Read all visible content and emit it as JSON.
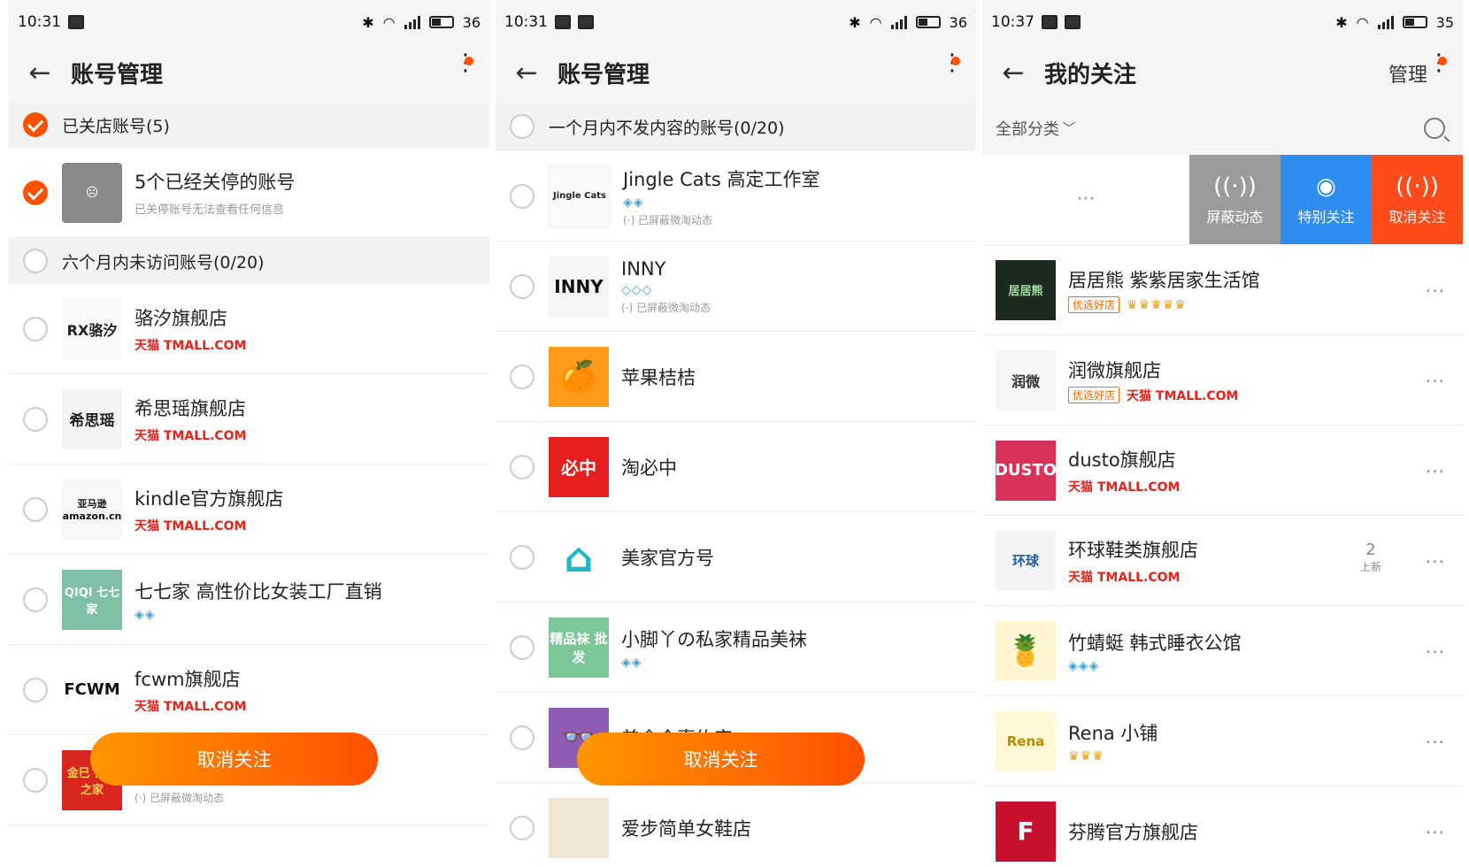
{
  "screens": [
    {
      "status": {
        "time": "10:31",
        "battery": "36"
      },
      "header": {
        "title": "账号管理"
      },
      "group1": {
        "label": "已关店账号(5)"
      },
      "closed_row": {
        "name": "5个已经关停的账号",
        "sub": "已关停账号无法查看任何信息"
      },
      "group2": {
        "label": "六个月内未访问账号(0/20)"
      },
      "rows": [
        {
          "name": "骆汐旗舰店",
          "tag": "天猫 TMALL.COM",
          "logo": "RX骆汐"
        },
        {
          "name": "希思瑶旗舰店",
          "tag": "天猫 TMALL.COM",
          "logo": "希思瑶"
        },
        {
          "name": "kindle官方旗舰店",
          "tag": "天猫 TMALL.COM",
          "logo": "亚马逊 amazon.cn"
        },
        {
          "name": "七七家 高性价比女装工厂直销",
          "tag": "◈◈",
          "logo": "QIQI 七七家"
        },
        {
          "name": "fcwm旗舰店",
          "tag": "天猫 TMALL.COM",
          "logo": "FCWM"
        },
        {
          "name": "",
          "tag": "(·) 已屏蔽微淘动态",
          "logo": "金巳 饰品之家"
        }
      ],
      "button": "取消关注"
    },
    {
      "status": {
        "time": "10:31",
        "battery": "36"
      },
      "header": {
        "title": "账号管理"
      },
      "group1": {
        "label": "一个月内不发内容的账号(0/20)"
      },
      "rows": [
        {
          "name": "Jingle Cats 高定工作室",
          "badges": "◈◈",
          "hint": "(·) 已屏蔽微淘动态",
          "logo": "Jingle Cats"
        },
        {
          "name": "INNY",
          "badges": "◇◇◇",
          "hint": "(·) 已屏蔽微淘动态",
          "logo": "INNY"
        },
        {
          "name": "苹果桔桔",
          "badges": "",
          "hint": "",
          "logo": "🍊"
        },
        {
          "name": "淘必中",
          "badges": "",
          "hint": "",
          "logo": "必中"
        },
        {
          "name": "美家官方号",
          "badges": "",
          "hint": "",
          "logo": "⌂"
        },
        {
          "name": "小脚丫の私家精品美袜",
          "badges": "◈◈",
          "hint": "",
          "logo": "精品袜 批发"
        },
        {
          "name": "美食今喜约定",
          "badges": "",
          "hint": "",
          "logo": "👓"
        },
        {
          "name": "爱步简单女鞋店",
          "badges": "",
          "hint": "",
          "logo": ""
        }
      ],
      "button": "取消关注"
    },
    {
      "status": {
        "time": "10:37",
        "battery": "35"
      },
      "header": {
        "title": "我的关注",
        "manage": "管理"
      },
      "filter": {
        "label": "全部分类",
        "chevron": "﹀"
      },
      "swipe_actions": [
        {
          "label": "屏蔽动态",
          "icon": "((·))",
          "color": "#9b9b9b"
        },
        {
          "label": "特别关注",
          "icon": "◉",
          "color": "#2f8df0"
        },
        {
          "label": "取消关注",
          "icon": "((·))",
          "color": "#ff4a1a"
        }
      ],
      "swipe_ghost": "···",
      "rows": [
        {
          "name": "居居熊 紫紫居家生活馆",
          "good": "优选好店",
          "tag": "",
          "badges": "♛♛♛♛♛",
          "logo": "居居熊",
          "new_count": "",
          "new_label": ""
        },
        {
          "name": "润微旗舰店",
          "good": "优选好店",
          "tag": "天猫 TMALL.COM",
          "badges": "",
          "logo": "润微",
          "new_count": "",
          "new_label": ""
        },
        {
          "name": "dusto旗舰店",
          "good": "",
          "tag": "天猫 TMALL.COM",
          "badges": "",
          "logo": "DUSTO",
          "new_count": "",
          "new_label": ""
        },
        {
          "name": "环球鞋类旗舰店",
          "good": "",
          "tag": "天猫 TMALL.COM",
          "badges": "",
          "logo": "环球",
          "new_count": "2",
          "new_label": "上新"
        },
        {
          "name": "竹蜻蜓 韩式睡衣公馆",
          "good": "",
          "tag": "",
          "badges": "◈◈◈",
          "logo": "🍍",
          "new_count": "",
          "new_label": ""
        },
        {
          "name": "Rena 小铺",
          "good": "",
          "tag": "",
          "badges": "♛♛♛",
          "logo": "Rena",
          "new_count": "",
          "new_label": ""
        },
        {
          "name": "芬腾官方旗舰店",
          "good": "",
          "tag": "",
          "badges": "",
          "logo": "F",
          "new_count": "",
          "new_label": ""
        }
      ],
      "row_more": "···"
    }
  ]
}
